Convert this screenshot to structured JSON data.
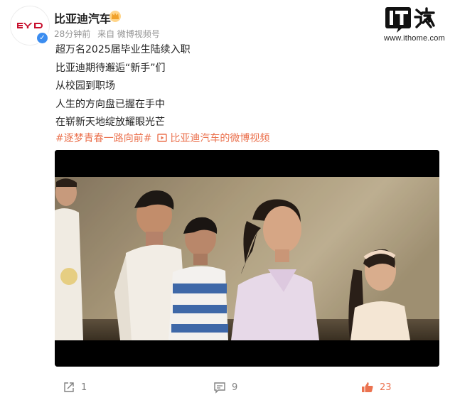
{
  "post": {
    "author": "比亚迪汽车",
    "avatar_text": "BYD",
    "time": "28分钟前",
    "source": "来自 微博视频号",
    "lines": [
      "超万名2025届毕业生陆续入职",
      "比亚迪期待邂逅“新手”们",
      "从校园到职场",
      "人生的方向盘已握在手中",
      "在崭新天地绽放耀眼光芒"
    ],
    "topic_tag": "#逐梦青春一路向前#",
    "video_link": "比亚迪汽车的微博视频"
  },
  "watermark": {
    "logo": "IT之家",
    "url": "www.ithome.com"
  },
  "actions": {
    "share_count": "1",
    "comment_count": "9",
    "like_count": "23"
  },
  "colors": {
    "brand_red": "#c8102e",
    "tag_orange": "#eb7350",
    "verified_blue": "#3b8df0"
  }
}
